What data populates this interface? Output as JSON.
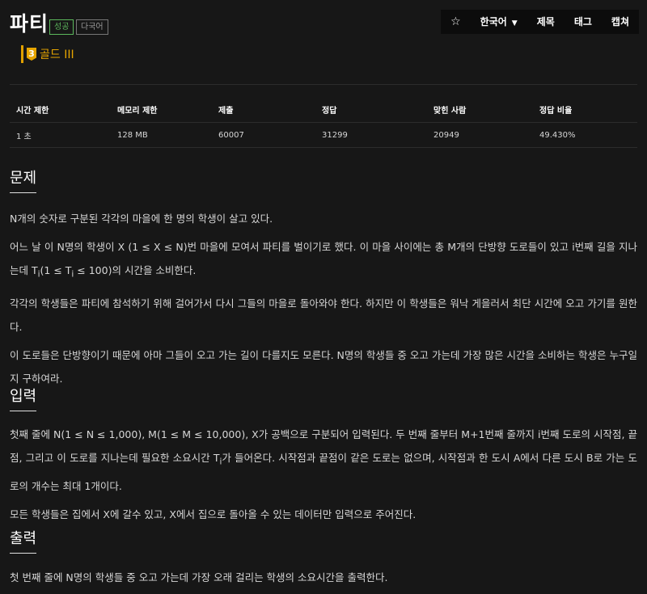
{
  "problem": {
    "title": "파티",
    "badges": {
      "success": "성공",
      "multilang": "다국어"
    },
    "tier": {
      "level": "3",
      "name": "골드 III"
    }
  },
  "nav": {
    "star": "☆",
    "language": "한국어",
    "items": [
      "제목",
      "태그",
      "캡쳐"
    ]
  },
  "info_table": {
    "headers": [
      "시간 제한",
      "메모리 제한",
      "제출",
      "정답",
      "맞힌 사람",
      "정답 비율"
    ],
    "row": [
      "1 초",
      "128 MB",
      "60007",
      "31299",
      "20949",
      "49.430%"
    ]
  },
  "sections": {
    "problem": {
      "heading": "문제",
      "p1": "N개의 숫자로 구분된 각각의 마을에 한 명의 학생이 살고 있다.",
      "p2a": "어느 날 이 N명의 학생이 X (1 ≤ X ≤ N)번 마을에 모여서 파티를 벌이기로 했다. 이 마을 사이에는 총 M개의 단방향 도로들이 있고 i번째 길을 지나는데 T",
      "p2b": "(1 ≤ T",
      "p2c": " ≤ 100)의 시간을 소비한다.",
      "sub_i": "i",
      "p3": "각각의 학생들은 파티에 참석하기 위해 걸어가서 다시 그들의 마을로 돌아와야 한다. 하지만 이 학생들은 워낙 게을러서 최단 시간에 오고 가기를 원한다.",
      "p4": "이 도로들은 단방향이기 때문에 아마 그들이 오고 가는 길이 다를지도 모른다. N명의 학생들 중 오고 가는데 가장 많은 시간을 소비하는 학생은 누구일지 구하여라."
    },
    "input": {
      "heading": "입력",
      "p1a": "첫째 줄에 N(1 ≤ N ≤ 1,000), M(1 ≤ M ≤ 10,000), X가 공백으로 구분되어 입력된다. 두 번째 줄부터 M+1번째 줄까지 i번째 도로의 시작점, 끝점, 그리고 이 도로를 지나는데 필요한 소요시간 T",
      "p1b": "가 들어온다. 시작점과 끝점이 같은 도로는 없으며, 시작점과 한 도시 A에서 다른 도시 B로 가는 도로의 개수는 최대 1개이다.",
      "sub_i": "i",
      "p2": "모든 학생들은 집에서 X에 갈수 있고, X에서 집으로 돌아올 수 있는 데이터만 입력으로 주어진다."
    },
    "output": {
      "heading": "출력",
      "p1": "첫 번째 줄에 N명의 학생들 중 오고 가는데 가장 오래 걸리는 학생의 소요시간을 출력한다."
    }
  },
  "colors": {
    "background": "#171717",
    "tier_gold": "#e7a500",
    "success_green": "#5cb85c"
  }
}
